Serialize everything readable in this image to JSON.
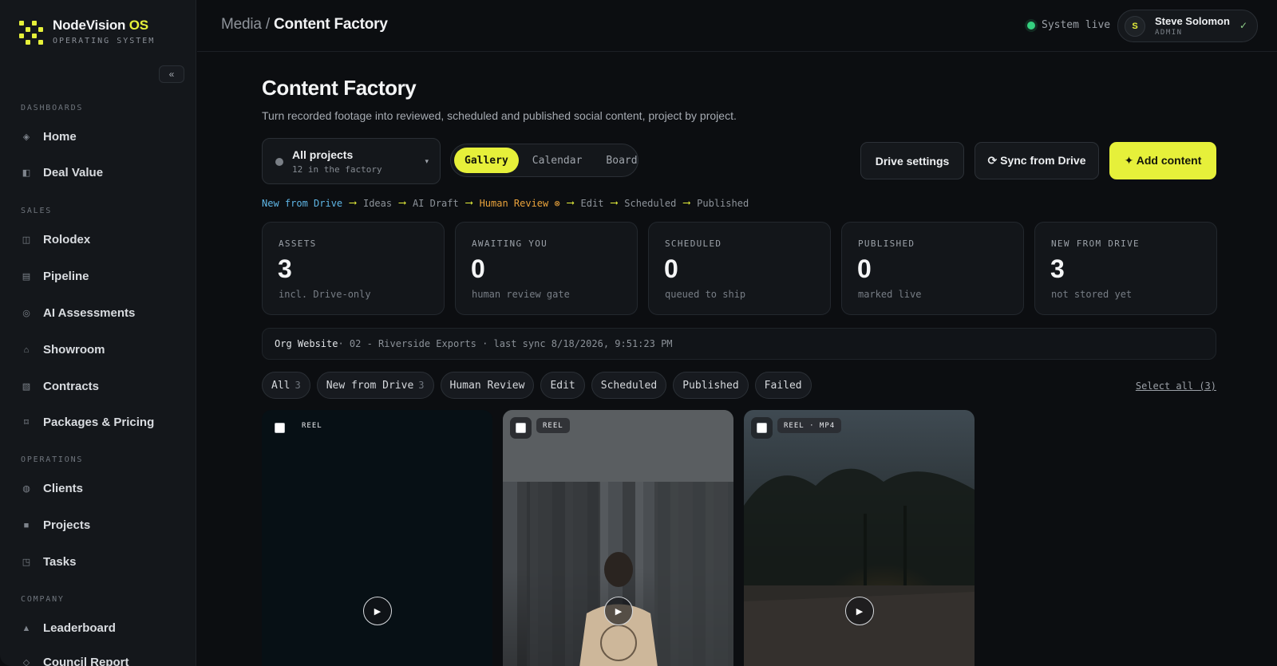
{
  "brand": {
    "name": "NodeVision",
    "name_accent": "OS",
    "subtitle": "OPERATING SYSTEM",
    "collapse_label": "«"
  },
  "sidebar": {
    "sections": [
      {
        "title": "DASHBOARDS",
        "items": [
          {
            "label": "Home",
            "icon": "diamond-icon",
            "glyph": "◈"
          },
          {
            "label": "Deal Value",
            "icon": "half-square-icon",
            "glyph": "◧"
          }
        ]
      },
      {
        "title": "SALES",
        "items": [
          {
            "label": "Rolodex",
            "icon": "columns-icon",
            "glyph": "◫"
          },
          {
            "label": "Pipeline",
            "icon": "grid-icon",
            "glyph": "▤"
          },
          {
            "label": "AI Assessments",
            "icon": "target-icon",
            "glyph": "◎"
          },
          {
            "label": "Showroom",
            "icon": "house-icon",
            "glyph": "⌂"
          },
          {
            "label": "Contracts",
            "icon": "hatched-square-icon",
            "glyph": "▧"
          },
          {
            "label": "Packages & Pricing",
            "icon": "package-icon",
            "glyph": "⌑"
          }
        ]
      },
      {
        "title": "OPERATIONS",
        "items": [
          {
            "label": "Clients",
            "icon": "circle-dot-icon",
            "glyph": "◍"
          },
          {
            "label": "Projects",
            "icon": "square-icon",
            "glyph": "■"
          },
          {
            "label": "Tasks",
            "icon": "task-square-icon",
            "glyph": "◳"
          }
        ]
      },
      {
        "title": "COMPANY",
        "items": [
          {
            "label": "Leaderboard",
            "icon": "triangle-icon",
            "glyph": "▲"
          },
          {
            "label": "Council Report",
            "icon": "report-icon",
            "glyph": "◇"
          }
        ]
      }
    ]
  },
  "topbar": {
    "breadcrumb_parent": "Media /",
    "breadcrumb_current": "Content Factory",
    "status": "System live",
    "user": {
      "initial": "S",
      "name": "Steve Solomon",
      "role": "ADMIN",
      "check": "✓"
    }
  },
  "page": {
    "title": "Content Factory",
    "subtitle": "Turn recorded footage into reviewed, scheduled and published social content, project by project."
  },
  "project_select": {
    "name": "All projects",
    "count": "12 in the factory",
    "caret": "▾"
  },
  "views": [
    "Gallery",
    "Calendar",
    "Board"
  ],
  "buttons": {
    "drive_settings": "Drive settings",
    "sync": "⟳ Sync from Drive",
    "add": "✦ Add content"
  },
  "pipeline": [
    "New from Drive",
    "Ideas",
    "AI Draft",
    "Human Review ⊗",
    "Edit",
    "Scheduled",
    "Published"
  ],
  "stats": [
    {
      "label": "ASSETS",
      "value": "3",
      "note": "incl. Drive-only"
    },
    {
      "label": "AWAITING YOU",
      "value": "0",
      "note": "human review gate"
    },
    {
      "label": "SCHEDULED",
      "value": "0",
      "note": "queued to ship"
    },
    {
      "label": "PUBLISHED",
      "value": "0",
      "note": "marked live"
    },
    {
      "label": "NEW FROM DRIVE",
      "value": "3",
      "note": "not stored yet"
    }
  ],
  "sync_bar": {
    "org": "Org Website",
    "details": " · 02 - Riverside Exports · last sync 8/18/2026, 9:51:23 PM"
  },
  "filters": [
    {
      "label": "All",
      "count": "3"
    },
    {
      "label": "New from Drive",
      "count": "3"
    },
    {
      "label": "Human Review",
      "count": ""
    },
    {
      "label": "Edit",
      "count": ""
    },
    {
      "label": "Scheduled",
      "count": ""
    },
    {
      "label": "Published",
      "count": ""
    },
    {
      "label": "Failed",
      "count": ""
    }
  ],
  "select_all": "Select all (3)",
  "cards": [
    {
      "tag": "REEL"
    },
    {
      "tag": "REEL"
    },
    {
      "tag": "REEL · MP4"
    }
  ],
  "colors": {
    "accent": "#e6f03a",
    "live": "#35d07f",
    "drive_blue": "#5fb6e6",
    "review_orange": "#e9a23b"
  }
}
